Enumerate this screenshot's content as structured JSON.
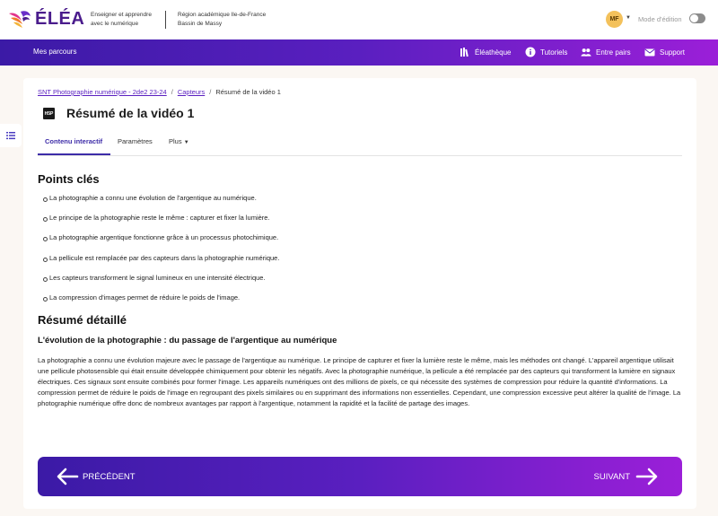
{
  "brand": {
    "name": "ÉLÉA",
    "tagline": "Enseigner et apprendre avec le numérique",
    "region_line1": "Région académique Ile-de-France",
    "region_line2": "Bassin de Massy"
  },
  "user": {
    "initials": "MF",
    "edit_mode_label": "Mode d'édition"
  },
  "nav": {
    "mes_parcours": "Mes parcours",
    "items": [
      {
        "label": "Éléathèque",
        "icon": "books-icon"
      },
      {
        "label": "Tutoriels",
        "icon": "info-icon"
      },
      {
        "label": "Entre pairs",
        "icon": "users-icon"
      },
      {
        "label": "Support",
        "icon": "mail-heart-icon"
      }
    ]
  },
  "breadcrumb": {
    "course": "SNT Photographie numérique - 2de2 23-24",
    "section": "Capteurs",
    "current": "Résumé de la vidéo 1"
  },
  "activity": {
    "type_badge": "H5P",
    "title": "Résumé de la vidéo 1"
  },
  "tabs": [
    {
      "label": "Contenu interactif",
      "active": true
    },
    {
      "label": "Paramètres",
      "active": false
    },
    {
      "label": "Plus",
      "active": false
    }
  ],
  "content": {
    "key_points_heading": "Points clés",
    "key_points": [
      "La photographie a connu une évolution de l'argentique au numérique.",
      "Le principe de la photographie reste le même : capturer et fixer la lumière.",
      "La photographie argentique fonctionne grâce à un processus photochimique.",
      "La pellicule est remplacée par des capteurs dans la photographie numérique.",
      "Les capteurs transforment le signal lumineux en une intensité électrique.",
      "La compression d'images permet de réduire le poids de l'image."
    ],
    "detail_heading": "Résumé détaillé",
    "detail_subheading": "L'évolution de la photographie : du passage de l'argentique au numérique",
    "detail_paragraph": "La photographie a connu une évolution majeure avec le passage de l'argentique au numérique. Le principe de capturer et fixer la lumière reste le même, mais les méthodes ont changé. L'appareil argentique utilisait une pellicule photosensible qui était ensuite développée chimiquement pour obtenir les négatifs. Avec la photographie numérique, la pellicule a été remplacée par des capteurs qui transforment la lumière en signaux électriques. Ces signaux sont ensuite combinés pour former l'image. Les appareils numériques ont des millions de pixels, ce qui nécessite des systèmes de compression pour réduire la quantité d'informations. La compression permet de réduire le poids de l'image en regroupant des pixels similaires ou en supprimant des informations non essentielles. Cependant, une compression excessive peut altérer la qualité de l'image. La photographie numérique offre donc de nombreux avantages par rapport à l'argentique, notamment la rapidité et la facilité de partage des images."
  },
  "pager": {
    "prev_label": "PRÉCÉDENT",
    "next_label": "SUIVANT"
  },
  "colors": {
    "brand_purple": "#5a1fc0",
    "gradient_start": "#3b1aa6",
    "gradient_end": "#9b1fd8",
    "avatar_bg": "#f3c15b"
  }
}
